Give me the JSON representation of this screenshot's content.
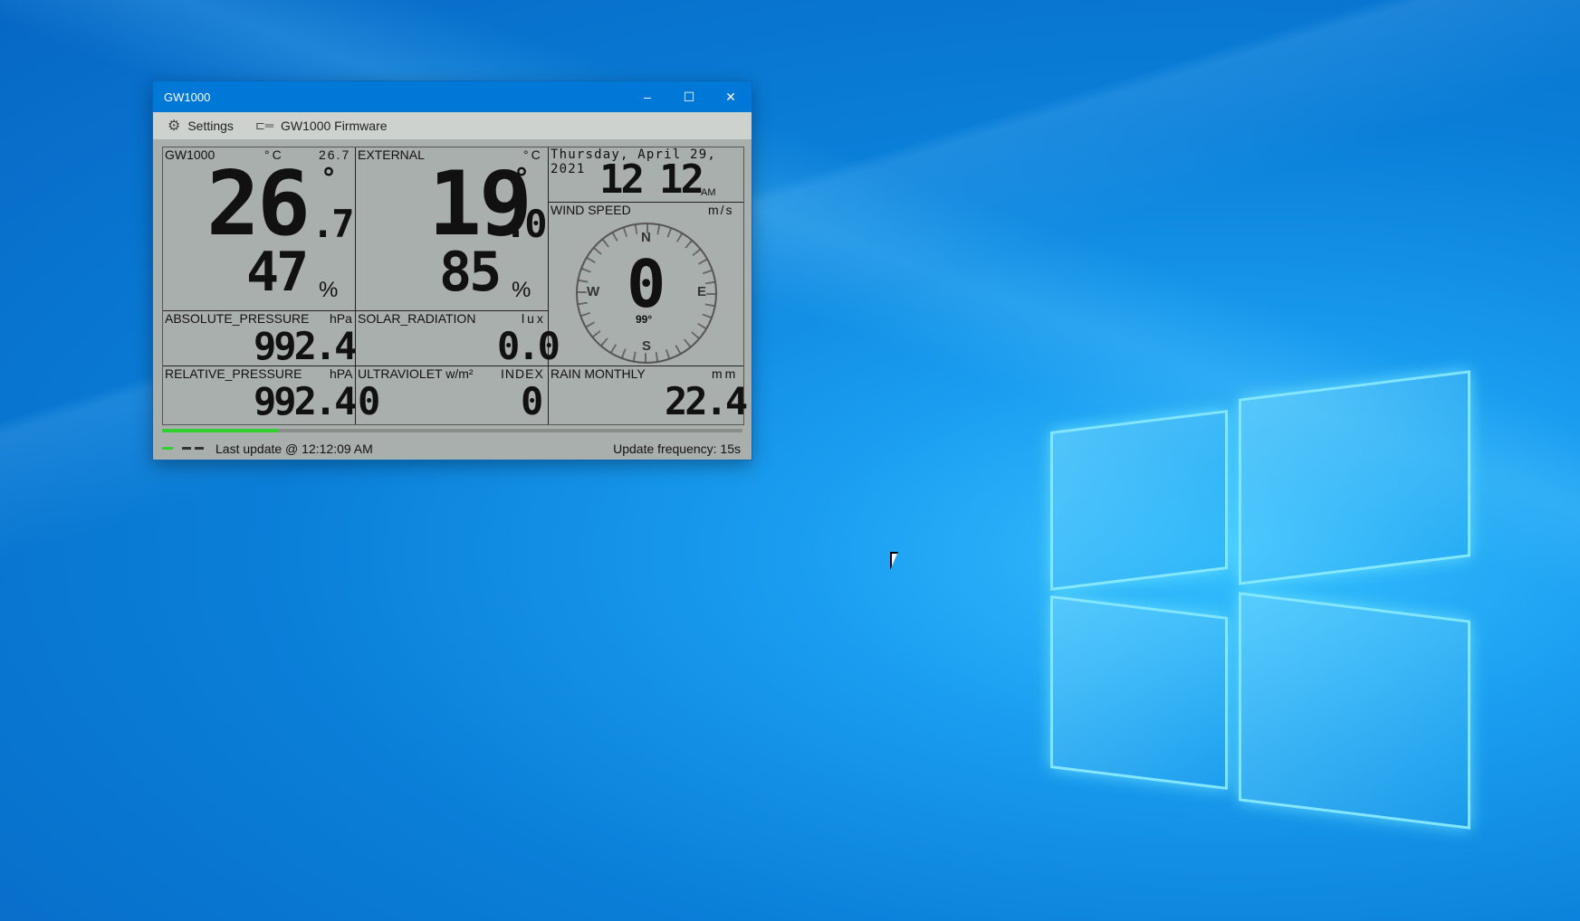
{
  "window": {
    "title": "GW1000",
    "controls": {
      "minimize": "–",
      "maximize": "☐",
      "close": "✕"
    }
  },
  "menu": {
    "settings_label": "Settings",
    "firmware_label": "GW1000 Firmware",
    "settings_icon": "gear-icon",
    "firmware_icon": "plug-icon"
  },
  "gw1000": {
    "label": "GW1000",
    "unit": "°C",
    "small_value": "26.7",
    "temp_int": "26",
    "temp_dec": ".7",
    "deg": "°",
    "humidity": "47",
    "humidity_unit": "%"
  },
  "external": {
    "label": "EXTERNAL",
    "unit": "°C",
    "temp_int": "19",
    "temp_dec": ".0",
    "deg": "°",
    "humidity": "85",
    "humidity_unit": "%"
  },
  "clock": {
    "date": "Thursday, April 29, 2021",
    "hour": "12",
    "minute": "12",
    "ampm": "AM"
  },
  "wind": {
    "label": "WIND SPEED",
    "unit": "m/s",
    "speed": "0",
    "direction": "99°",
    "n": "N",
    "s": "S",
    "e": "E",
    "w": "W"
  },
  "abs_pressure": {
    "label": "ABSOLUTE_PRESSURE",
    "unit": "hPa",
    "value": "992.4"
  },
  "solar": {
    "label": "SOLAR_RADIATION",
    "unit": "lux",
    "value": "0.0"
  },
  "rel_pressure": {
    "label": "RELATIVE_PRESSURE",
    "unit": "hPA",
    "value": "992.4"
  },
  "uv": {
    "label": "ULTRAVIOLET w/m²",
    "index_label": "INDEX",
    "value": "0",
    "index": "0"
  },
  "rain": {
    "label": "RAIN MONTHLY",
    "unit": "mm",
    "value": "22.4"
  },
  "status": {
    "last_update": "Last update @ 12:12:09 AM",
    "frequency": "Update frequency: 15s",
    "progress_fraction": 0.2,
    "accent": "#2fd12f"
  }
}
